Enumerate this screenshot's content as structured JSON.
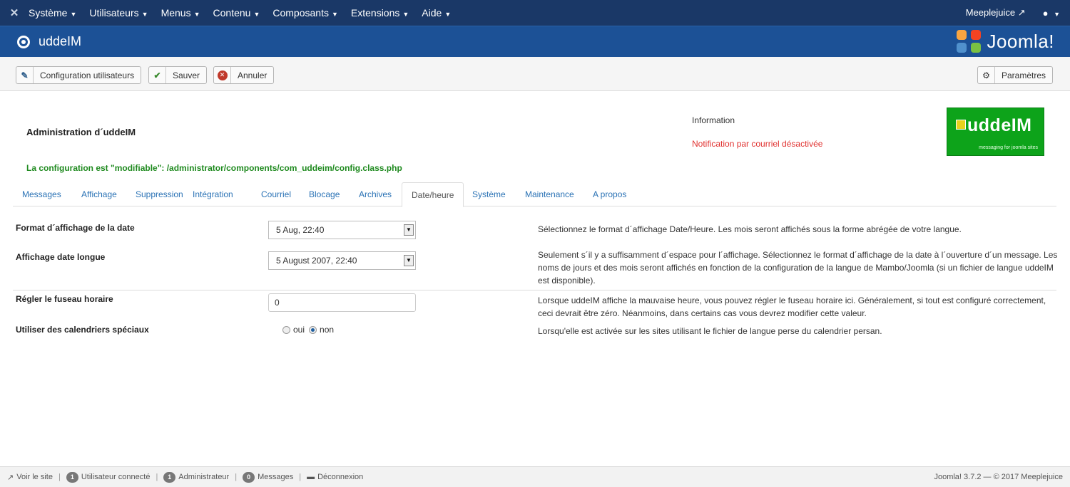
{
  "topnav": {
    "menus": [
      "Système",
      "Utilisateurs",
      "Menus",
      "Contenu",
      "Composants",
      "Extensions",
      "Aide"
    ],
    "site_link": "Meeplejuice",
    "user_icon": "user-icon"
  },
  "header": {
    "title": "uddeIM",
    "brand": "Joomla!"
  },
  "toolbar": {
    "config_users": "Configuration utilisateurs",
    "save": "Sauver",
    "cancel": "Annuler",
    "params": "Paramètres"
  },
  "admin": {
    "title": "Administration d´uddeIM",
    "info_label": "Information",
    "notification": "Notification par courriel désactivée",
    "config_note": "La configuration est \"modifiable\": /administrator/components/com_uddeim/config.class.php",
    "logo_text": "uddeIM",
    "logo_sub": "messaging for joomla sites"
  },
  "tabs": [
    "Messages",
    "Affichage",
    "Suppression",
    "Intégration",
    "Courriel",
    "Blocage",
    "Archives",
    "Date/heure",
    "Système",
    "Maintenance",
    "A propos"
  ],
  "active_tab": "Date/heure",
  "form": {
    "date_format": {
      "label": "Format d´affichage de la date",
      "value": "5 Aug, 22:40",
      "desc": "Sélectionnez le format d´affichage Date/Heure. Les mois seront affichés sous la forme abrégée de votre langue."
    },
    "long_date": {
      "label": "Affichage date longue",
      "value": "5 August 2007, 22:40",
      "desc": "Seulement s´il y a suffisamment d´espace pour l´affichage. Sélectionnez le format d´affichage de la date à l´ouverture d´un message. Les noms de jours et des mois seront affichés en fonction de la configuration de la langue de Mambo/Joomla (si un fichier de langue uddeIM est disponible)."
    },
    "timezone": {
      "label": "Régler le fuseau horaire",
      "value": "0",
      "desc": "Lorsque uddeIM affiche la mauvaise heure, vous pouvez régler le fuseau horaire ici. Généralement, si tout est configuré correctement, ceci devrait être zéro. Néanmoins, dans certains cas vous devrez modifier cette valeur."
    },
    "special_calendars": {
      "label": "Utiliser des calendriers spéciaux",
      "yes": "oui",
      "no": "non",
      "selected": "non",
      "desc": "Lorsqu'elle est activée sur les sites utilisant le fichier de langue perse du calendrier persan."
    }
  },
  "footer": {
    "view_site": "Voir le site",
    "users_count": "1",
    "users_label": "Utilisateur connecté",
    "admin_count": "1",
    "admin_label": "Administrateur",
    "msg_count": "0",
    "msg_label": "Messages",
    "logout": "Déconnexion",
    "copyright": "Joomla! 3.7.2 — © 2017 Meeplejuice"
  }
}
